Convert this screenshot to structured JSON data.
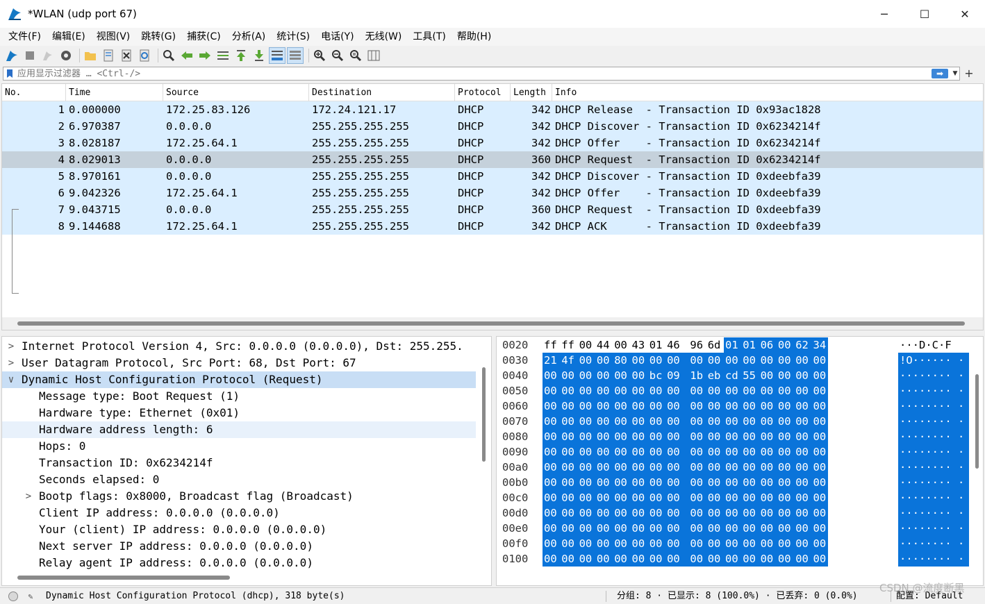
{
  "window": {
    "title": "*WLAN (udp port 67)",
    "minimize": "─",
    "maximize": "☐",
    "close": "✕"
  },
  "menu": [
    "文件(F)",
    "编辑(E)",
    "视图(V)",
    "跳转(G)",
    "捕获(C)",
    "分析(A)",
    "统计(S)",
    "电话(Y)",
    "无线(W)",
    "工具(T)",
    "帮助(H)"
  ],
  "filter": {
    "placeholder": "应用显示过滤器 … <Ctrl-/>",
    "apply_arrow": "➡",
    "dropdown": "▼",
    "add": "+"
  },
  "packet_list": {
    "columns": [
      "No.",
      "Time",
      "Source",
      "Destination",
      "Protocol",
      "Length",
      "Info"
    ],
    "rows": [
      {
        "no": "1",
        "time": "0.000000",
        "src": "172.25.83.126",
        "dst": "172.24.121.17",
        "proto": "DHCP",
        "len": "342",
        "info": "DHCP Release  - Transaction ID 0x93ac1828"
      },
      {
        "no": "2",
        "time": "6.970387",
        "src": "0.0.0.0",
        "dst": "255.255.255.255",
        "proto": "DHCP",
        "len": "342",
        "info": "DHCP Discover - Transaction ID 0x6234214f"
      },
      {
        "no": "3",
        "time": "8.028187",
        "src": "172.25.64.1",
        "dst": "255.255.255.255",
        "proto": "DHCP",
        "len": "342",
        "info": "DHCP Offer    - Transaction ID 0x6234214f"
      },
      {
        "no": "4",
        "time": "8.029013",
        "src": "0.0.0.0",
        "dst": "255.255.255.255",
        "proto": "DHCP",
        "len": "360",
        "info": "DHCP Request  - Transaction ID 0x6234214f"
      },
      {
        "no": "5",
        "time": "8.970161",
        "src": "0.0.0.0",
        "dst": "255.255.255.255",
        "proto": "DHCP",
        "len": "342",
        "info": "DHCP Discover - Transaction ID 0xdeebfa39"
      },
      {
        "no": "6",
        "time": "9.042326",
        "src": "172.25.64.1",
        "dst": "255.255.255.255",
        "proto": "DHCP",
        "len": "342",
        "info": "DHCP Offer    - Transaction ID 0xdeebfa39"
      },
      {
        "no": "7",
        "time": "9.043715",
        "src": "0.0.0.0",
        "dst": "255.255.255.255",
        "proto": "DHCP",
        "len": "360",
        "info": "DHCP Request  - Transaction ID 0xdeebfa39"
      },
      {
        "no": "8",
        "time": "9.144688",
        "src": "172.25.64.1",
        "dst": "255.255.255.255",
        "proto": "DHCP",
        "len": "342",
        "info": "DHCP ACK      - Transaction ID 0xdeebfa39"
      }
    ]
  },
  "details": {
    "rows": [
      {
        "arrow": ">",
        "text": "Internet Protocol Version 4, Src: 0.0.0.0 (0.0.0.0), Dst: 255.255.",
        "level": 0
      },
      {
        "arrow": ">",
        "text": "User Datagram Protocol, Src Port: 68, Dst Port: 67",
        "level": 0
      },
      {
        "arrow": "∨",
        "text": "Dynamic Host Configuration Protocol (Request)",
        "level": 0
      },
      {
        "arrow": "",
        "text": "Message type: Boot Request (1)",
        "level": 1
      },
      {
        "arrow": "",
        "text": "Hardware type: Ethernet (0x01)",
        "level": 1
      },
      {
        "arrow": "",
        "text": "Hardware address length: 6",
        "level": 1
      },
      {
        "arrow": "",
        "text": "Hops: 0",
        "level": 1
      },
      {
        "arrow": "",
        "text": "Transaction ID: 0x6234214f",
        "level": 1
      },
      {
        "arrow": "",
        "text": "Seconds elapsed: 0",
        "level": 1
      },
      {
        "arrow": ">",
        "text": "Bootp flags: 0x8000, Broadcast flag (Broadcast)",
        "level": 1
      },
      {
        "arrow": "",
        "text": "Client IP address: 0.0.0.0 (0.0.0.0)",
        "level": 1
      },
      {
        "arrow": "",
        "text": "Your (client) IP address: 0.0.0.0 (0.0.0.0)",
        "level": 1
      },
      {
        "arrow": "",
        "text": "Next server IP address: 0.0.0.0 (0.0.0.0)",
        "level": 1
      },
      {
        "arrow": "",
        "text": "Relay agent IP address: 0.0.0.0 (0.0.0.0)",
        "level": 1
      }
    ]
  },
  "bytes": {
    "rows": [
      {
        "off": "0020",
        "hex": [
          "ff",
          "ff",
          "00",
          "44",
          "00",
          "43",
          "01",
          "46",
          "96",
          "6d",
          "01",
          "01",
          "06",
          "00",
          "62",
          "34"
        ],
        "ascii": "···D·C·F"
      },
      {
        "off": "0030",
        "hex": [
          "21",
          "4f",
          "00",
          "00",
          "80",
          "00",
          "00",
          "00",
          "00",
          "00",
          "00",
          "00",
          "00",
          "00",
          "00",
          "00"
        ],
        "ascii": "!O······ ·"
      },
      {
        "off": "0040",
        "hex": [
          "00",
          "00",
          "00",
          "00",
          "00",
          "00",
          "bc",
          "09",
          "1b",
          "eb",
          "cd",
          "55",
          "00",
          "00",
          "00",
          "00"
        ],
        "ascii": "········ ·"
      },
      {
        "off": "0050",
        "hex": [
          "00",
          "00",
          "00",
          "00",
          "00",
          "00",
          "00",
          "00",
          "00",
          "00",
          "00",
          "00",
          "00",
          "00",
          "00",
          "00"
        ],
        "ascii": "········ ·"
      },
      {
        "off": "0060",
        "hex": [
          "00",
          "00",
          "00",
          "00",
          "00",
          "00",
          "00",
          "00",
          "00",
          "00",
          "00",
          "00",
          "00",
          "00",
          "00",
          "00"
        ],
        "ascii": "········ ·"
      },
      {
        "off": "0070",
        "hex": [
          "00",
          "00",
          "00",
          "00",
          "00",
          "00",
          "00",
          "00",
          "00",
          "00",
          "00",
          "00",
          "00",
          "00",
          "00",
          "00"
        ],
        "ascii": "········ ·"
      },
      {
        "off": "0080",
        "hex": [
          "00",
          "00",
          "00",
          "00",
          "00",
          "00",
          "00",
          "00",
          "00",
          "00",
          "00",
          "00",
          "00",
          "00",
          "00",
          "00"
        ],
        "ascii": "········ ·"
      },
      {
        "off": "0090",
        "hex": [
          "00",
          "00",
          "00",
          "00",
          "00",
          "00",
          "00",
          "00",
          "00",
          "00",
          "00",
          "00",
          "00",
          "00",
          "00",
          "00"
        ],
        "ascii": "········ ·"
      },
      {
        "off": "00a0",
        "hex": [
          "00",
          "00",
          "00",
          "00",
          "00",
          "00",
          "00",
          "00",
          "00",
          "00",
          "00",
          "00",
          "00",
          "00",
          "00",
          "00"
        ],
        "ascii": "········ ·"
      },
      {
        "off": "00b0",
        "hex": [
          "00",
          "00",
          "00",
          "00",
          "00",
          "00",
          "00",
          "00",
          "00",
          "00",
          "00",
          "00",
          "00",
          "00",
          "00",
          "00"
        ],
        "ascii": "········ ·"
      },
      {
        "off": "00c0",
        "hex": [
          "00",
          "00",
          "00",
          "00",
          "00",
          "00",
          "00",
          "00",
          "00",
          "00",
          "00",
          "00",
          "00",
          "00",
          "00",
          "00"
        ],
        "ascii": "········ ·"
      },
      {
        "off": "00d0",
        "hex": [
          "00",
          "00",
          "00",
          "00",
          "00",
          "00",
          "00",
          "00",
          "00",
          "00",
          "00",
          "00",
          "00",
          "00",
          "00",
          "00"
        ],
        "ascii": "········ ·"
      },
      {
        "off": "00e0",
        "hex": [
          "00",
          "00",
          "00",
          "00",
          "00",
          "00",
          "00",
          "00",
          "00",
          "00",
          "00",
          "00",
          "00",
          "00",
          "00",
          "00"
        ],
        "ascii": "········ ·"
      },
      {
        "off": "00f0",
        "hex": [
          "00",
          "00",
          "00",
          "00",
          "00",
          "00",
          "00",
          "00",
          "00",
          "00",
          "00",
          "00",
          "00",
          "00",
          "00",
          "00"
        ],
        "ascii": "········ ·"
      },
      {
        "off": "0100",
        "hex": [
          "00",
          "00",
          "00",
          "00",
          "00",
          "00",
          "00",
          "00",
          "00",
          "00",
          "00",
          "00",
          "00",
          "00",
          "00",
          "00"
        ],
        "ascii": "········ ·"
      }
    ]
  },
  "status": {
    "protocol_text": "Dynamic Host Configuration Protocol (dhcp), 318 byte(s)",
    "packets": "分组: 8 · 已显示: 8 (100.0%) · 已丢弃: 0 (0.0%)",
    "profile": "配置: Default"
  },
  "watermark": "CSDN @流度断黑"
}
